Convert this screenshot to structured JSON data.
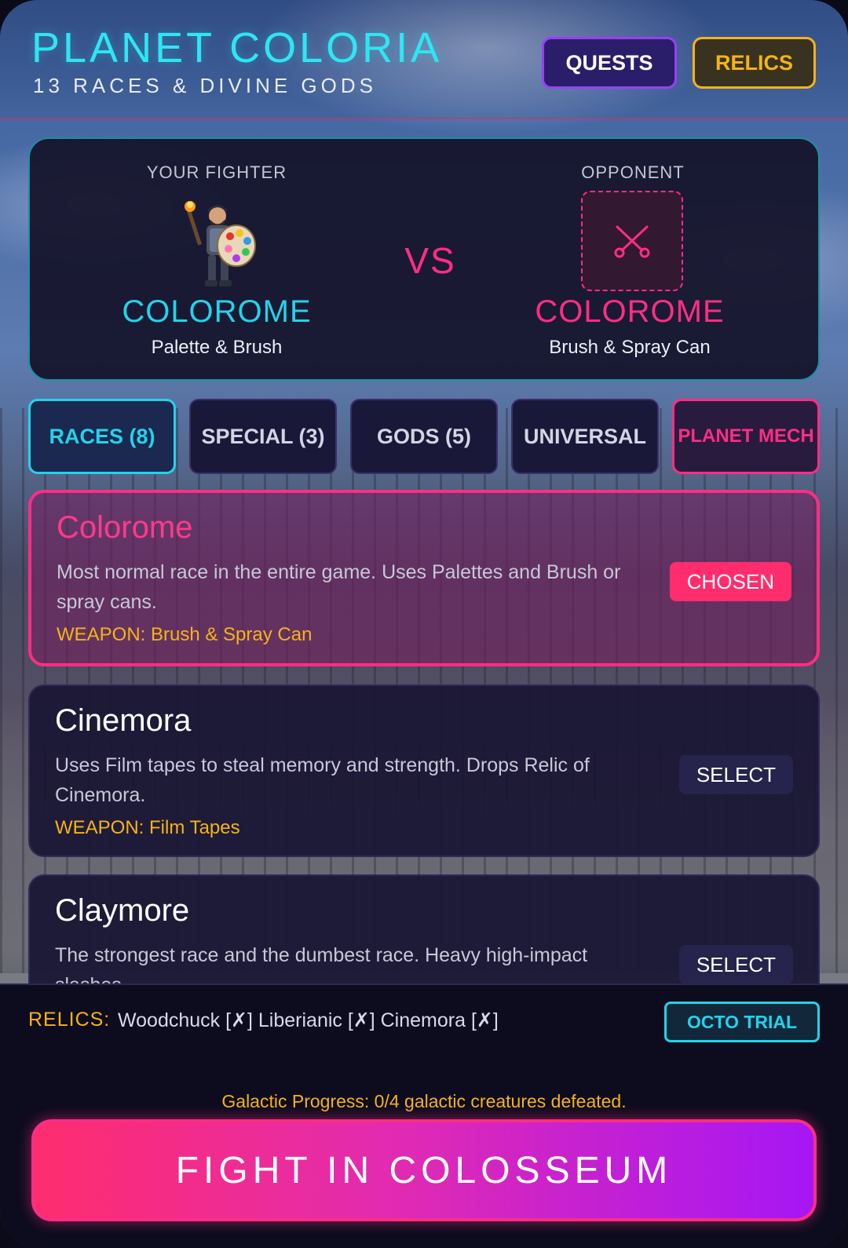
{
  "header": {
    "title": "PLANET COLORIA",
    "subtitle": "13 RACES & DIVINE GODS",
    "quests_label": "QUESTS",
    "relics_label": "RELICS"
  },
  "matchup": {
    "player": {
      "label": "YOUR FIGHTER",
      "name": "COLOROME",
      "weapon": "Palette & Brush"
    },
    "vs": "VS",
    "opponent": {
      "label": "OPPONENT",
      "name": "COLOROME",
      "weapon": "Brush & Spray Can",
      "icon": "crossed-swords-icon"
    }
  },
  "tabs": [
    {
      "label": "RACES (8)",
      "active": true
    },
    {
      "label": "SPECIAL (3)",
      "active": false
    },
    {
      "label": "GODS (5)",
      "active": false
    },
    {
      "label": "UNIVERSAL",
      "active": false
    },
    {
      "label": "PLANET MECH",
      "active": false
    }
  ],
  "races": [
    {
      "name": "Colorome",
      "description": "Most normal race in the entire game. Uses Palettes and Brush or spray cans.",
      "weapon": "WEAPON: Brush & Spray Can",
      "button": "CHOSEN",
      "chosen": true
    },
    {
      "name": "Cinemora",
      "description": "Uses Film tapes to steal memory and strength. Drops Relic of Cinemora.",
      "weapon": "WEAPON: Film Tapes",
      "button": "SELECT",
      "chosen": false
    },
    {
      "name": "Claymore",
      "description": "The strongest race and the dumbest race. Heavy high-impact slashes.",
      "weapon": "",
      "button": "SELECT",
      "chosen": false
    }
  ],
  "footer": {
    "relics_label": "RELICS:",
    "relics_list": "Woodchuck [✗] Liberianic [✗] Cinemora [✗]",
    "octo_trial": "OCTO TRIAL",
    "progress": "Galactic Progress: 0/4 galactic creatures defeated.",
    "fight_label": "FIGHT IN COLOSSEUM"
  },
  "colors": {
    "accent_cyan": "#22d3ea",
    "accent_pink": "#ff2d84",
    "accent_gold": "#f5b318",
    "accent_purple": "#9b3dff"
  }
}
